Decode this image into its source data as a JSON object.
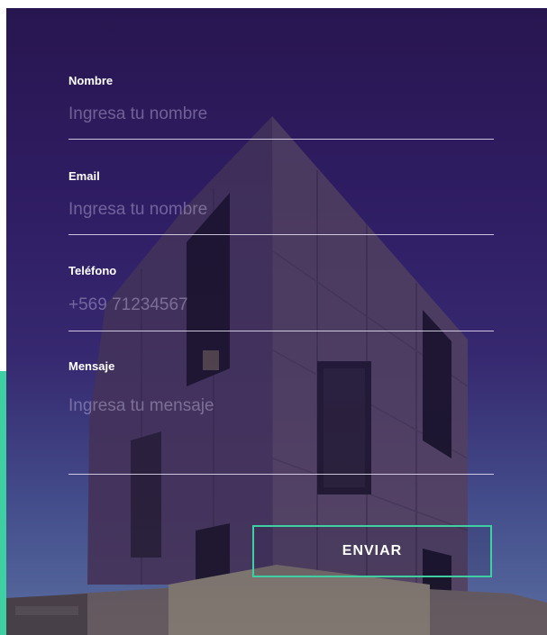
{
  "form": {
    "name": {
      "label": "Nombre",
      "placeholder": "Ingresa tu nombre"
    },
    "email": {
      "label": "Email",
      "placeholder": "Ingresa tu nombre"
    },
    "phone": {
      "label": "Teléfono",
      "placeholder": "+569 71234567"
    },
    "message": {
      "label": "Mensaje",
      "placeholder": "Ingresa tu mensaje"
    },
    "submit_label": "ENVIAR"
  },
  "colors": {
    "accent": "#3ecfa3",
    "background_top": "#2a1852",
    "background_bottom": "#5f77a8",
    "text": "#ffffff"
  }
}
